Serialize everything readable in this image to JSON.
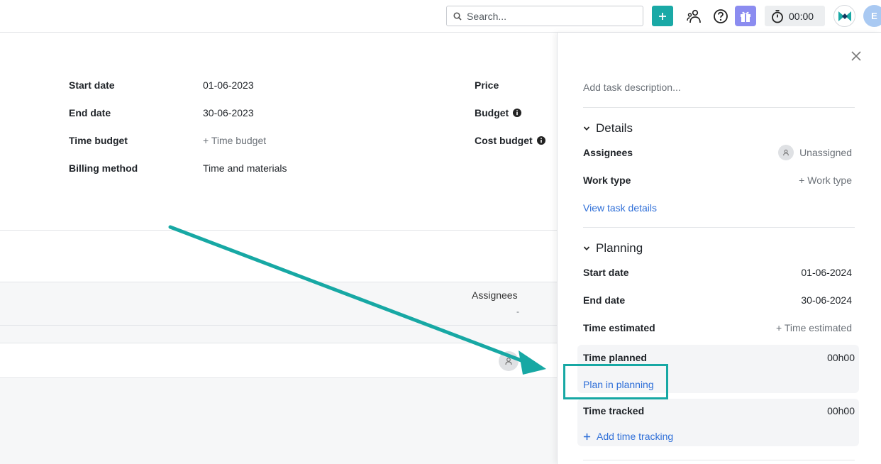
{
  "topbar": {
    "search_placeholder": "Search...",
    "timer_value": "00:00",
    "avatar_initial": "E"
  },
  "project": {
    "fields_left": [
      {
        "label": "Start date",
        "value": "01-06-2023"
      },
      {
        "label": "End date",
        "value": "30-06-2023"
      },
      {
        "label": "Time budget",
        "value": "+ Time budget"
      },
      {
        "label": "Billing method",
        "value": "Time and materials"
      }
    ],
    "fields_right": [
      {
        "label": "Price"
      },
      {
        "label": "Budget"
      },
      {
        "label": "Cost budget"
      }
    ]
  },
  "table": {
    "assignees_header": "Assignees",
    "assignees_empty": "-"
  },
  "panel": {
    "description_placeholder": "Add task description...",
    "details": {
      "title": "Details",
      "assignees_label": "Assignees",
      "assignees_value": "Unassigned",
      "worktype_label": "Work type",
      "worktype_value": "+ Work type",
      "view_details_link": "View task details"
    },
    "planning": {
      "title": "Planning",
      "start_label": "Start date",
      "start_value": "01-06-2024",
      "end_label": "End date",
      "end_value": "30-06-2024",
      "estimated_label": "Time estimated",
      "estimated_value": "+ Time estimated",
      "planned_label": "Time planned",
      "planned_value": "00h00",
      "plan_link": "Plan in planning",
      "tracked_label": "Time tracked",
      "tracked_value": "00h00",
      "add_tracking_link": "Add time tracking"
    }
  },
  "colors": {
    "accent": "#1aa9a6",
    "link": "#2f6fd8",
    "gift": "#8b8cf0"
  }
}
